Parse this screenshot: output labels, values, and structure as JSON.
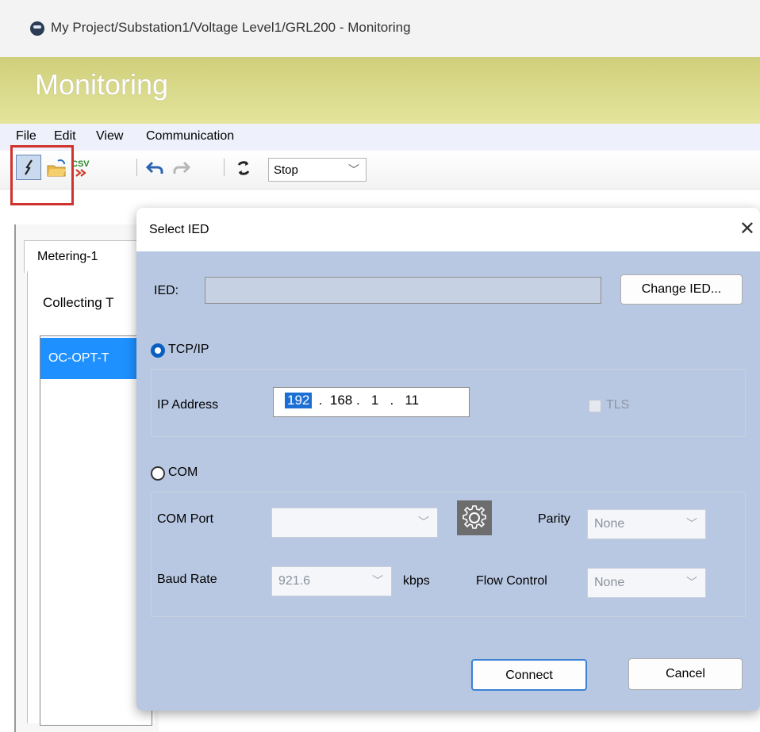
{
  "window": {
    "title": "My Project/Substation1/Voltage Level1/GRL200 - Monitoring"
  },
  "banner": {
    "heading": "Monitoring"
  },
  "menu": {
    "items": [
      "File",
      "Edit",
      "View",
      "Communication"
    ]
  },
  "toolbar": {
    "mode_select": "Stop"
  },
  "background": {
    "tab_label": "Metering-1",
    "collecting_text": "Collecting T",
    "list_item": "OC-OPT-T"
  },
  "dialog": {
    "title": "Select IED",
    "close": "✕",
    "ied_label": "IED:",
    "ied_value": "",
    "change_ied_button": "Change IED...",
    "tcpip": {
      "radio_label": "TCP/IP",
      "selected": true,
      "ip_label": "IP Address",
      "ip_octet1": "192",
      "ip_rest": " .  168 .   1   .   11",
      "tls_label": "TLS",
      "tls_checked": false
    },
    "com": {
      "radio_label": "COM",
      "selected": false,
      "port_label": "COM Port",
      "port_value": "",
      "parity_label": "Parity",
      "parity_value": "None",
      "baud_label": "Baud Rate",
      "baud_value": "921.6",
      "baud_unit": "kbps",
      "flow_label": "Flow Control",
      "flow_value": "None"
    },
    "connect_button": "Connect",
    "cancel_button": "Cancel"
  },
  "colors": {
    "banner": "#d6d688",
    "dialog_bg": "#b9c8e2",
    "highlight": "#d0332e",
    "selection": "#1e90ff"
  }
}
